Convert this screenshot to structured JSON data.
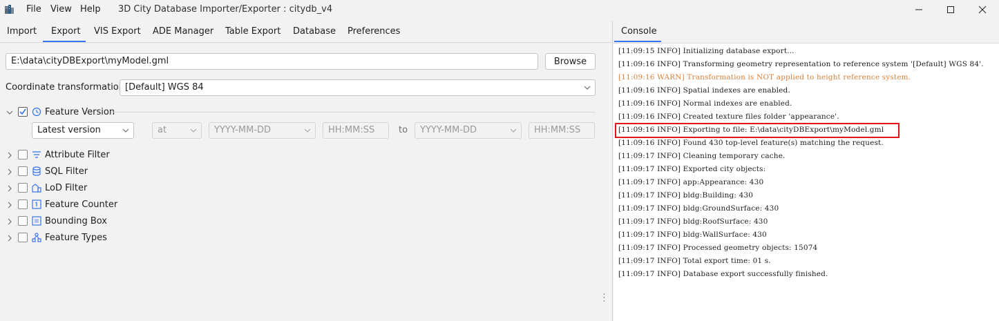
{
  "window": {
    "title": "3D City Database Importer/Exporter : citydb_v4",
    "menu": [
      "File",
      "View",
      "Help"
    ]
  },
  "tabs": [
    "Import",
    "Export",
    "VIS Export",
    "ADE Manager",
    "Table Export",
    "Database",
    "Preferences"
  ],
  "active_tab": "Export",
  "export": {
    "file_path": "E:\\data\\cityDBExport\\myModel.gml",
    "browse_label": "Browse",
    "coord_label": "Coordinate transformation",
    "coord_value": "[Default] WGS 84",
    "feature_version": {
      "label": "Feature Version",
      "checked": true,
      "version_select": "Latest version",
      "at_select": "at",
      "date1_placeholder": "YYYY-MM-DD",
      "time1_placeholder": "HH:MM:SS",
      "to_label": "to",
      "date2_placeholder": "YYYY-MM-DD",
      "time2_placeholder": "HH:MM:SS"
    },
    "filters": [
      {
        "label": "Attribute Filter",
        "icon": "filter-icon"
      },
      {
        "label": "SQL Filter",
        "icon": "database-icon"
      },
      {
        "label": "LoD Filter",
        "icon": "lod-icon"
      },
      {
        "label": "Feature Counter",
        "icon": "counter-icon"
      },
      {
        "label": "Bounding Box",
        "icon": "bounding-box-icon"
      },
      {
        "label": "Feature Types",
        "icon": "feature-types-icon"
      }
    ]
  },
  "console": {
    "tab_label": "Console",
    "lines": [
      {
        "text": "[11:09:15 INFO] Initializing database export...",
        "level": "info"
      },
      {
        "text": "[11:09:16 INFO] Transforming geometry representation to reference system '[Default] WGS 84'.",
        "level": "info"
      },
      {
        "text": "[11:09:16 WARN] Transformation is NOT applied to height reference system.",
        "level": "warn"
      },
      {
        "text": "[11:09:16 INFO] Spatial indexes are enabled.",
        "level": "info"
      },
      {
        "text": "[11:09:16 INFO] Normal indexes are enabled.",
        "level": "info"
      },
      {
        "text": "[11:09:16 INFO] Created texture files folder 'appearance'.",
        "level": "info"
      },
      {
        "text": "[11:09:16 INFO] Exporting to file: E:\\data\\cityDBExport\\myModel.gml",
        "level": "info"
      },
      {
        "text": "[11:09:16 INFO] Found 430 top-level feature(s) matching the request.",
        "level": "info"
      },
      {
        "text": "[11:09:17 INFO] Cleaning temporary cache.",
        "level": "info"
      },
      {
        "text": "[11:09:17 INFO] Exported city objects:",
        "level": "info"
      },
      {
        "text": "[11:09:17 INFO] app:Appearance: 430",
        "level": "info"
      },
      {
        "text": "[11:09:17 INFO] bldg:Building: 430",
        "level": "info"
      },
      {
        "text": "[11:09:17 INFO] bldg:GroundSurface: 430",
        "level": "info"
      },
      {
        "text": "[11:09:17 INFO] bldg:RoofSurface: 430",
        "level": "info"
      },
      {
        "text": "[11:09:17 INFO] bldg:WallSurface: 430",
        "level": "info"
      },
      {
        "text": "[11:09:17 INFO] Processed geometry objects: 15074",
        "level": "info"
      },
      {
        "text": "[11:09:17 INFO] Total export time: 01 s.",
        "level": "info"
      },
      {
        "text": "[11:09:17 INFO] Database export successfully finished.",
        "level": "info"
      }
    ]
  },
  "colors": {
    "accent": "#3574f0",
    "warn": "#d9823b",
    "highlight": "#e0161b"
  }
}
